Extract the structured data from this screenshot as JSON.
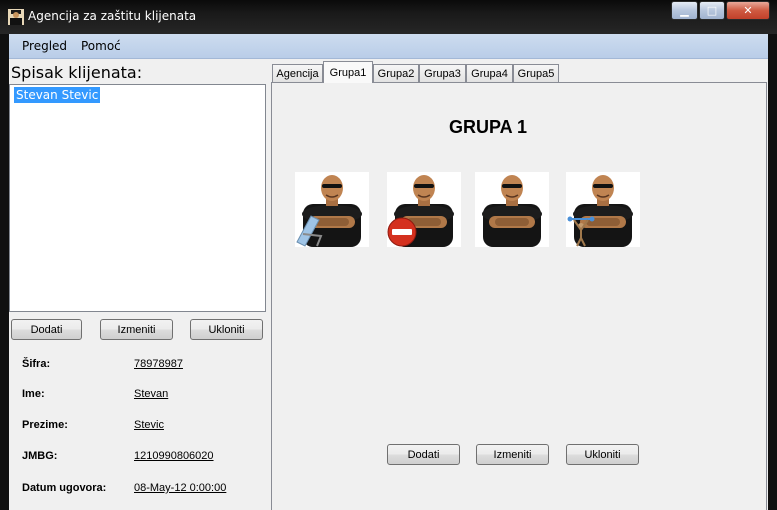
{
  "window": {
    "title": "Agencija za zaštitu klijenata"
  },
  "menu": [
    {
      "label": "Pregled"
    },
    {
      "label": "Pomoć"
    }
  ],
  "left": {
    "list_title": "Spisak klijenata:",
    "clients": [
      "Stevan Stevic"
    ],
    "buttons": {
      "add": "Dodati",
      "edit": "Izmeniti",
      "remove": "Ukloniti"
    },
    "details": {
      "sifra": {
        "label": "Šifra:",
        "value": "78978987"
      },
      "ime": {
        "label": "Ime:",
        "value": "Stevan"
      },
      "prezime": {
        "label": "Prezime:",
        "value": "Stevic"
      },
      "jmbg": {
        "label": "JMBG:",
        "value": "1210990806020"
      },
      "datum": {
        "label": "Datum ugovora:",
        "value": "08-May-12 0:00:00"
      }
    }
  },
  "tabs": [
    {
      "label": "Agencija"
    },
    {
      "label": "Grupa1"
    },
    {
      "label": "Grupa2"
    },
    {
      "label": "Grupa3"
    },
    {
      "label": "Grupa4"
    },
    {
      "label": "Grupa5"
    }
  ],
  "active_tab": "Grupa1",
  "group": {
    "title": "GRUPA 1",
    "guards": [
      {
        "status_icon": "beach-chair-icon"
      },
      {
        "status_icon": "no-entry-icon"
      },
      {
        "status_icon": "none"
      },
      {
        "status_icon": "weightlifter-icon"
      }
    ],
    "buttons": {
      "add": "Dodati",
      "edit": "Izmeniti",
      "remove": "Ukloniti"
    }
  },
  "colors": {
    "selection": "#3399ff",
    "menubar": "#c4d6ee",
    "no_entry": "#d4301e"
  }
}
